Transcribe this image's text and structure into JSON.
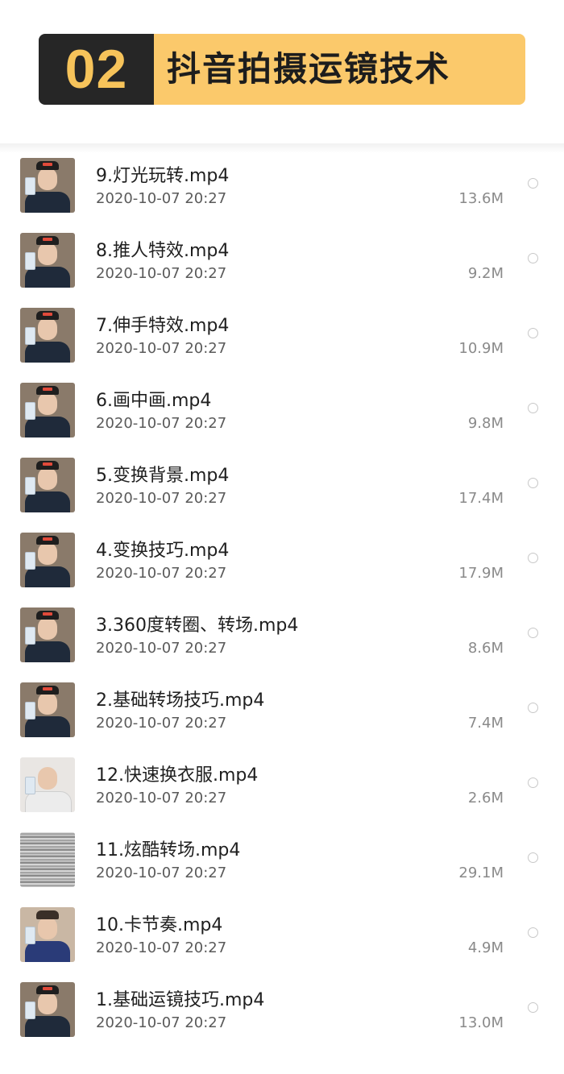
{
  "banner": {
    "number": "02",
    "title": "抖音拍摄运镜技术"
  },
  "files": [
    {
      "name": "9.灯光玩转.mp4",
      "date": "2020-10-07 20:27",
      "size": "13.6M",
      "thumb": "person-icon"
    },
    {
      "name": "8.推人特效.mp4",
      "date": "2020-10-07 20:27",
      "size": "9.2M",
      "thumb": "person-icon"
    },
    {
      "name": "7.伸手特效.mp4",
      "date": "2020-10-07 20:27",
      "size": "10.9M",
      "thumb": "person-icon"
    },
    {
      "name": "6.画中画.mp4",
      "date": "2020-10-07 20:27",
      "size": "9.8M",
      "thumb": "person-icon"
    },
    {
      "name": "5.变换背景.mp4",
      "date": "2020-10-07 20:27",
      "size": "17.4M",
      "thumb": "person-icon"
    },
    {
      "name": "4.变换技巧.mp4",
      "date": "2020-10-07 20:27",
      "size": "17.9M",
      "thumb": "person-icon"
    },
    {
      "name": "3.360度转圈、转场.mp4",
      "date": "2020-10-07 20:27",
      "size": "8.6M",
      "thumb": "person-icon"
    },
    {
      "name": "2.基础转场技巧.mp4",
      "date": "2020-10-07 20:27",
      "size": "7.4M",
      "thumb": "person-icon"
    },
    {
      "name": "12.快速换衣服.mp4",
      "date": "2020-10-07 20:27",
      "size": "2.6M",
      "thumb": "person-light-icon"
    },
    {
      "name": "11.炫酷转场.mp4",
      "date": "2020-10-07 20:27",
      "size": "29.1M",
      "thumb": "noise-texture-icon"
    },
    {
      "name": "10.卡节奏.mp4",
      "date": "2020-10-07 20:27",
      "size": "4.9M",
      "thumb": "person-room-icon"
    },
    {
      "name": "1.基础运镜技巧.mp4",
      "date": "2020-10-07 20:27",
      "size": "13.0M",
      "thumb": "person-icon"
    }
  ],
  "colors": {
    "banner_dark": "#262626",
    "banner_yellow": "#fbc96b",
    "number_yellow": "#f6c35a"
  }
}
